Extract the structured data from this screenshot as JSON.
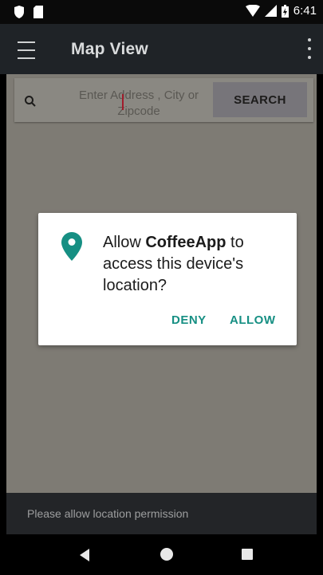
{
  "status_bar": {
    "time": "6:41",
    "icons": [
      "shield-icon",
      "sd-card-icon",
      "wifi-icon",
      "signal-icon",
      "battery-icon"
    ]
  },
  "app_bar": {
    "title": "Map View",
    "menu_icon": "hamburger-icon",
    "overflow_icon": "overflow-menu-icon"
  },
  "search": {
    "placeholder": "Enter Address , City or Zipcode",
    "value": "",
    "button_label": "SEARCH",
    "icon": "search-icon"
  },
  "dialog": {
    "message_prefix": "Allow ",
    "app_name": "CoffeeApp",
    "message_suffix": " to access this device's location?",
    "deny_label": "DENY",
    "allow_label": "ALLOW",
    "icon": "location-pin-icon",
    "accent_color": "#168f83"
  },
  "bottom_message": "Please allow location permission",
  "nav_bar": {
    "back_icon": "back-icon",
    "home_icon": "home-icon",
    "recents_icon": "recents-icon"
  }
}
